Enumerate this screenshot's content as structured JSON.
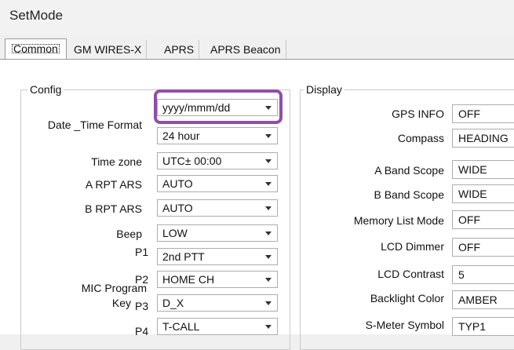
{
  "window": {
    "title": "SetMode"
  },
  "tabs": [
    {
      "label": "Common",
      "active": true
    },
    {
      "label": "GM WIRES-X"
    },
    {
      "label": "APRS"
    },
    {
      "label": "APRS Beacon"
    }
  ],
  "config": {
    "group_title": "Config",
    "date_time_format_label": "Date _Time Format",
    "date_format_value": "yyyy/mmm/dd",
    "time_format_value": "24 hour",
    "time_zone_label": "Time zone",
    "time_zone_value": "UTC± 00:00",
    "a_rpt_ars_label": "A RPT ARS",
    "a_rpt_ars_value": "AUTO",
    "b_rpt_ars_label": "B RPT ARS",
    "b_rpt_ars_value": "AUTO",
    "beep_label": "Beep",
    "beep_value": "LOW",
    "mic_program_key_label_1": "MIC Program",
    "mic_program_key_label_2": "Key",
    "p1_label": "P1",
    "p1_value": "2nd PTT",
    "p2_label": "P2",
    "p2_value": "HOME CH",
    "p3_label": "P3",
    "p3_value": "D_X",
    "p4_label": "P4",
    "p4_value": "T-CALL"
  },
  "display": {
    "group_title": "Display",
    "gps_info_label": "GPS INFO",
    "gps_info_value": "OFF",
    "compass_label": "Compass",
    "compass_value": "HEADING",
    "a_band_scope_label": "A Band Scope",
    "a_band_scope_value": "WIDE",
    "b_band_scope_label": "B Band Scope",
    "b_band_scope_value": "WIDE",
    "memory_list_mode_label": "Memory List Mode",
    "memory_list_mode_value": "OFF",
    "lcd_dimmer_label": "LCD Dimmer",
    "lcd_dimmer_value": "OFF",
    "lcd_contrast_label": "LCD Contrast",
    "lcd_contrast_value": "5",
    "backlight_color_label": "Backlight Color",
    "backlight_color_value": "AMBER",
    "s_meter_symbol_label": "S-Meter Symbol",
    "s_meter_symbol_value": "TYP1"
  },
  "colors": {
    "highlight": "#8f4fa8"
  }
}
